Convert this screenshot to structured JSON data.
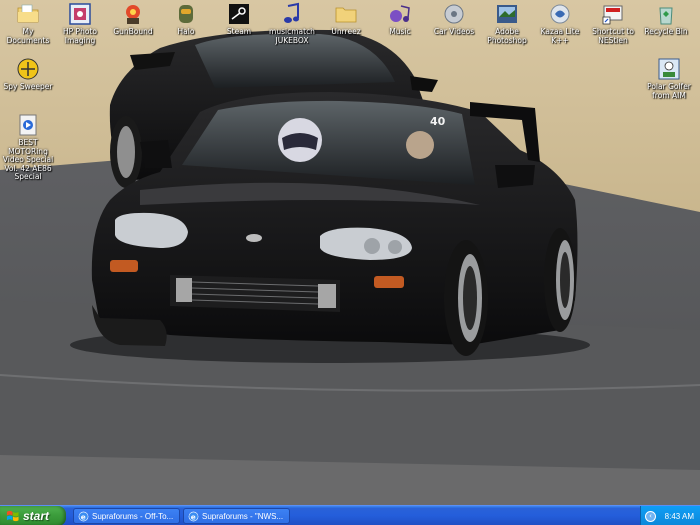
{
  "desktop": {
    "icons": [
      {
        "label": "My Documents",
        "icon": "folder-documents-icon"
      },
      {
        "label": "HP Photo Imaging",
        "icon": "hp-photo-icon"
      },
      {
        "label": "GunBound",
        "icon": "gunbound-icon"
      },
      {
        "label": "Halo",
        "icon": "halo-icon"
      },
      {
        "label": "Steam",
        "icon": "steam-icon"
      },
      {
        "label": "musicmatch JUKEBOX",
        "icon": "musicmatch-icon"
      },
      {
        "label": "Unrreez",
        "icon": "folder-icon"
      },
      {
        "label": "Music",
        "icon": "music-icon"
      },
      {
        "label": "Car Videos",
        "icon": "video-icon"
      },
      {
        "label": "Adobe Photoshop",
        "icon": "photoshop-icon"
      },
      {
        "label": "Kazaa Lite K++",
        "icon": "kazaa-icon"
      },
      {
        "label": "Shortcut to NEStien",
        "icon": "shortcut-icon"
      },
      {
        "label": "Recycle Bin",
        "icon": "recycle-bin-icon"
      },
      {
        "label": "Spy Sweeper",
        "icon": "spy-sweeper-icon"
      },
      {
        "label": "BEST MOTORing Video Special Vol. 42 AE86 Special",
        "icon": "video-file-icon"
      },
      {
        "label": "Polar Golfer from AIM",
        "icon": "polar-golfer-icon"
      }
    ]
  },
  "taskbar": {
    "start_label": "start",
    "tasks": [
      {
        "label": "Supraforums - Off-To..."
      },
      {
        "label": "Supraforums - \"NWS..."
      }
    ],
    "clock": "8:43 AM",
    "tray_expand": "‹"
  },
  "wallpaper": {
    "description_color": "#3a3a38",
    "car_number": "40"
  }
}
